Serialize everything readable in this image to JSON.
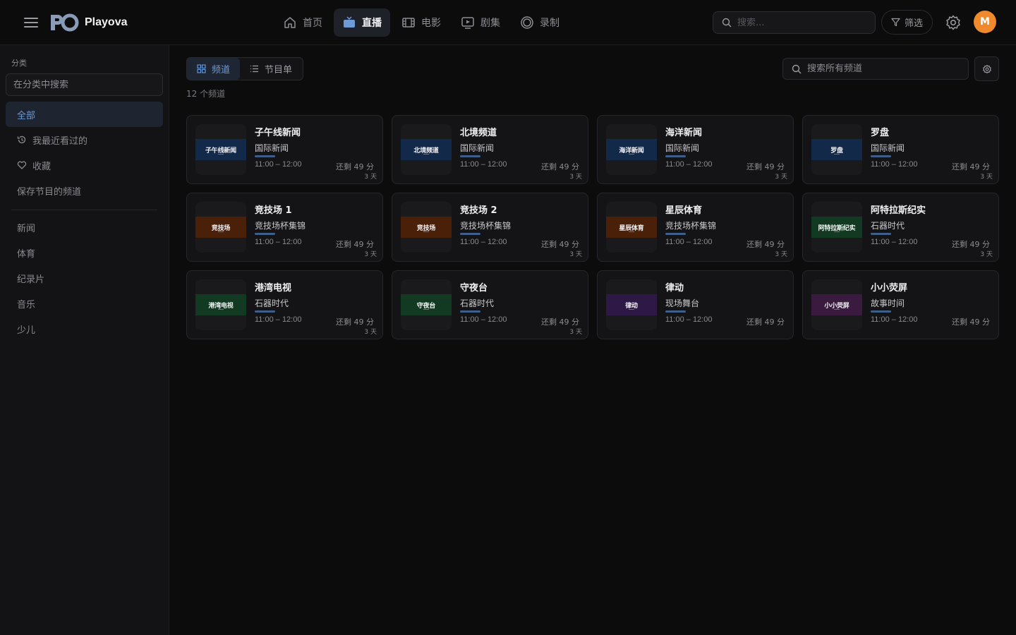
{
  "app": {
    "name": "Playova",
    "user_initial": "M"
  },
  "nav": [
    {
      "label": "首页",
      "icon": "home-icon",
      "active": false
    },
    {
      "label": "直播",
      "icon": "tv-icon",
      "active": true
    },
    {
      "label": "电影",
      "icon": "film-icon",
      "active": false
    },
    {
      "label": "剧集",
      "icon": "play-square-icon",
      "active": false
    },
    {
      "label": "录制",
      "icon": "record-icon",
      "active": false
    }
  ],
  "header": {
    "search_placeholder": "搜索...",
    "filter_label": "筛选"
  },
  "sidebar": {
    "title": "分类",
    "search_placeholder": "在分类中搜索",
    "items": [
      {
        "label": "全部",
        "active": true
      },
      {
        "label": "我最近看过的",
        "icon": "history-icon"
      },
      {
        "label": "收藏",
        "icon": "heart-icon"
      },
      {
        "label": "保存节目的频道"
      }
    ],
    "categories": [
      "新闻",
      "体育",
      "纪录片",
      "音乐",
      "少儿"
    ]
  },
  "main": {
    "view_toggle": [
      {
        "label": "频道",
        "active": true,
        "icon": "grid-icon"
      },
      {
        "label": "节目单",
        "active": false,
        "icon": "list-icon"
      }
    ],
    "channel_count": "12 个频道",
    "search_placeholder": "搜索所有频道"
  },
  "colors": {
    "accent": "#6c9bd8",
    "avatar": "#f08a2c",
    "progress": "#3d5f8a"
  },
  "channels": [
    {
      "thumb_label": "子午线新闻",
      "name": "子午线新闻",
      "program": "国际新闻",
      "time": "11:00 – 12:00",
      "remaining": "还剩 49 分",
      "days": "3 天",
      "progress": 0.18,
      "tint": "#13294a"
    },
    {
      "thumb_label": "北境频道",
      "name": "北境频道",
      "program": "国际新闻",
      "time": "11:00 – 12:00",
      "remaining": "还剩 49 分",
      "days": "3 天",
      "progress": 0.18,
      "tint": "#13294a"
    },
    {
      "thumb_label": "海洋新闻",
      "name": "海洋新闻",
      "program": "国际新闻",
      "time": "11:00 – 12:00",
      "remaining": "还剩 49 分",
      "days": "3 天",
      "progress": 0.18,
      "tint": "#13294a"
    },
    {
      "thumb_label": "罗盘",
      "name": "罗盘",
      "program": "国际新闻",
      "time": "11:00 – 12:00",
      "remaining": "还剩 49 分",
      "days": "3 天",
      "progress": 0.18,
      "tint": "#13294a"
    },
    {
      "thumb_label": "竞技场",
      "name": "竞技场 1",
      "program": "竞技场杯集锦",
      "time": "11:00 – 12:00",
      "remaining": "还剩 49 分",
      "days": "3 天",
      "progress": 0.18,
      "tint": "#4a2008"
    },
    {
      "thumb_label": "竞技场",
      "name": "竞技场 2",
      "program": "竞技场杯集锦",
      "time": "11:00 – 12:00",
      "remaining": "还剩 49 分",
      "days": "3 天",
      "progress": 0.18,
      "tint": "#4a2008"
    },
    {
      "thumb_label": "星辰体育",
      "name": "星辰体育",
      "program": "竞技场杯集锦",
      "time": "11:00 – 12:00",
      "remaining": "还剩 49 分",
      "days": "3 天",
      "progress": 0.18,
      "tint": "#4a2008"
    },
    {
      "thumb_label": "阿特拉斯纪实",
      "name": "阿特拉斯纪实",
      "program": "石器时代",
      "time": "11:00 – 12:00",
      "remaining": "还剩 49 分",
      "days": "3 天",
      "progress": 0.18,
      "tint": "#123a22"
    },
    {
      "thumb_label": "港湾电视",
      "name": "港湾电视",
      "program": "石器时代",
      "time": "11:00 – 12:00",
      "remaining": "还剩 49 分",
      "days": "3 天",
      "progress": 0.18,
      "tint": "#123a22"
    },
    {
      "thumb_label": "守夜台",
      "name": "守夜台",
      "program": "石器时代",
      "time": "11:00 – 12:00",
      "remaining": "还剩 49 分",
      "days": "3 天",
      "progress": 0.18,
      "tint": "#123a22"
    },
    {
      "thumb_label": "律动",
      "name": "律动",
      "program": "现场舞台",
      "time": "11:00 – 12:00",
      "remaining": "还剩 49 分",
      "days": "",
      "progress": 0.18,
      "tint": "#2e1846"
    },
    {
      "thumb_label": "小小荧屏",
      "name": "小小荧屏",
      "program": "故事时间",
      "time": "11:00 – 12:00",
      "remaining": "还剩 49 分",
      "days": "",
      "progress": 0.18,
      "tint": "#3a1a3e"
    }
  ]
}
